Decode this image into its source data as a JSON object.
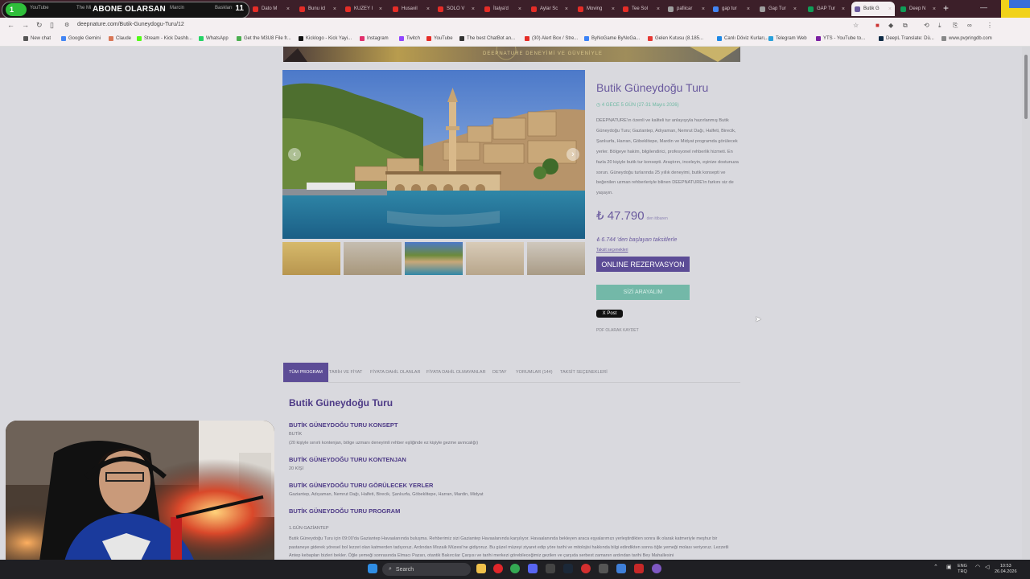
{
  "browser": {
    "stream_overlay": {
      "badge": "1",
      "text": "ABONE OLARSAN",
      "count": "11"
    },
    "tabs": [
      {
        "label": "YouTube",
        "color": "#e52d27"
      },
      {
        "label": "The Mi",
        "color": "#e52d27"
      },
      {
        "label": "Marcin",
        "color": "#e52d27"
      },
      {
        "label": "Baskları",
        "color": "#e52d27"
      },
      {
        "label": "Dato M",
        "color": "#e52d27"
      },
      {
        "label": "Bunu icl",
        "color": "#e52d27"
      },
      {
        "label": "KUZEY I",
        "color": "#e52d27"
      },
      {
        "label": "Husavil",
        "color": "#e52d27"
      },
      {
        "label": "SOLO V",
        "color": "#e52d27"
      },
      {
        "label": "İtalya'd",
        "color": "#e52d27"
      },
      {
        "label": "Aylar Sc",
        "color": "#e52d27"
      },
      {
        "label": "Moving",
        "color": "#e52d27"
      },
      {
        "label": "Tee Sol",
        "color": "#e52d27"
      },
      {
        "label": "pafiicar",
        "color": "#9e9e9e"
      },
      {
        "label": "gap tur",
        "color": "#4285f4"
      },
      {
        "label": "Gap Tur",
        "color": "#9e9e9e"
      },
      {
        "label": "GAP Tur",
        "color": "#0f9d58"
      },
      {
        "label": "Butik G",
        "color": "#6a5a9e"
      },
      {
        "label": "Deep N",
        "color": "#0f9d58"
      }
    ],
    "url": "deepnature.com/Butik-Guneydogu-Turu/12",
    "bookmarks": [
      {
        "label": "New chat",
        "color": "#555"
      },
      {
        "label": "Google Gemini",
        "color": "#4285f4"
      },
      {
        "label": "Claude",
        "color": "#d97757"
      },
      {
        "label": "Stream - Kick Dashb...",
        "color": "#53fc18"
      },
      {
        "label": "WhatsApp",
        "color": "#25d366"
      },
      {
        "label": "Get the M3U8 File fr...",
        "color": "#4caf50"
      },
      {
        "label": "Kicklogo - Kick Yayi...",
        "color": "#111"
      },
      {
        "label": "Instagram",
        "color": "#e1306c"
      },
      {
        "label": "Twitch",
        "color": "#9146ff"
      },
      {
        "label": "YouTube",
        "color": "#e52d27"
      },
      {
        "label": "The best ChatBot an...",
        "color": "#333"
      },
      {
        "label": "(30) Alert Box / Stre...",
        "color": "#e52d27"
      },
      {
        "label": "ByNoGame ByNoGa...",
        "color": "#3b82f6"
      },
      {
        "label": "Gelen Kutusu (8.185...",
        "color": "#e53935"
      },
      {
        "label": "Canlı Döviz Kurları,...",
        "color": "#1e88e5"
      },
      {
        "label": "Telegram Web",
        "color": "#2aa1da"
      },
      {
        "label": "YTS - YouTube to...",
        "color": "#7b1fa2"
      },
      {
        "label": "DeepL Translate: Dü...",
        "color": "#0f2b46"
      },
      {
        "label": "www.pvpringdb.com",
        "color": "#888"
      }
    ]
  },
  "page": {
    "banner_text": "DEEPNATURE DENEYİMİ VE GÜVENİYLE",
    "tour_title": "Butik Güneydoğu Turu",
    "duration": "4 GECE 5 GÜN (27-31 Mayıs 2026)",
    "description": "DEEPNATURE'ın özenli ve kaliteli tur anlayışıyla hazırlanmış Butik Güneydoğu Turu; Gaziantep, Adıyaman, Nemrut Dağı, Halfeti, Birecik, Şanlıurfa, Harran, Göbeklitepe, Mardin ve Midyat programda görülecek yerler. Bölgeye hakim, bilgilendirici, profesyonel rehberlik hizmeti. En fazla 20 kişiyle butik tur konsepti. Araştırın, inceleyin, eşinize dostunuza sorun. Güneydoğu turlarında 25 yıllık deneyimi, butik konsepti ve beğenilen uzman rehberleriyle bilinen DEEPNATURE'in farkını siz de yaşayın.",
    "price": "₺ 47.790",
    "price_note": "den itibaren",
    "installment": "₺ 6.744 'den başlayan taksitlerle",
    "installment_link": "Taksit seçenekleri",
    "online_button": "ONLINE REZERVASYON",
    "call_button": "SİZİ ARAYALIM",
    "x_post": "X Post",
    "pdf_link": "PDF OLARAK KAYDET",
    "content_tabs": [
      "TÜM PROGRAM",
      "TARİH VE FİYAT",
      "FİYATA DAHİL OLANLAR",
      "FİYATA DAHİL OLMAYANLAR",
      "DETAY",
      "YORUMLAR (144)",
      "TAKSİT SEÇENEKLERİ"
    ],
    "section_title": "Butik Güneydoğu Turu",
    "konsept_heading": "BUTİK GÜNEYDOĞU TURU KONSEPT",
    "konsept_line1": "BUTİK",
    "konsept_line2": "(20 kişiyle sınırlı kontenjan, bölge uzmanı deneyimli rehber eşliğinde ez kişiyle gezme avıncalığı)",
    "kontenjan_heading": "BUTİK GÜNEYDOĞU TURU KONTENJAN",
    "kontenjan_text": "20 KİŞİ",
    "yerler_heading": "BUTİK GÜNEYDOĞU TURU GÖRÜLECEK YERLER",
    "yerler_text": "Gaziantep, Adıyaman, Nemrut Dağı, Halfeti, Birecik, Şanlıurfa, Göbeklitepe, Harran, Mardin, Midyat",
    "program_heading": "BUTİK GÜNEYDOĞU TURU  PROGRAM",
    "day1_heading": "1.GÜN GAZİANTEP",
    "day1_text": "Butik Güneydoğu Turu için 09:00'da Gaziantep Havaalanında buluşma. Rehberimiz sizi Gaziantep Havaalanında karşılıyor. Havaalanında bekleyen araca eşyalarımızı yerleştirdikten sonra ilk olarak katmeriyle meşhur bir pastaneye giderek yöresel bol lezzet olan katmerden tadıyoruz. Ardından Mozaik Müzesi'ne gidiyoruz. Bu güzel müzeyi ziyaret edip yöre tarihi ve mitolojisi hakkında bilgi edindikten sonra öğle yemeği molası veriyoruz. Lezzetli Antep kebapları bizleri bekler. Öğle yemeği sonrasında Elmacı Pazarı, otantik Bakırcılar Çarşısı ve tarihi merkezi görebileceğimiz gezilen ve çarşıda serbest zamanın ardından tarihi Bey Mahallesini"
  },
  "taskbar": {
    "search_placeholder": "Search",
    "lang": "ENG",
    "lang2": "TRQ",
    "time": "10:53",
    "date": "26.04.2026"
  }
}
